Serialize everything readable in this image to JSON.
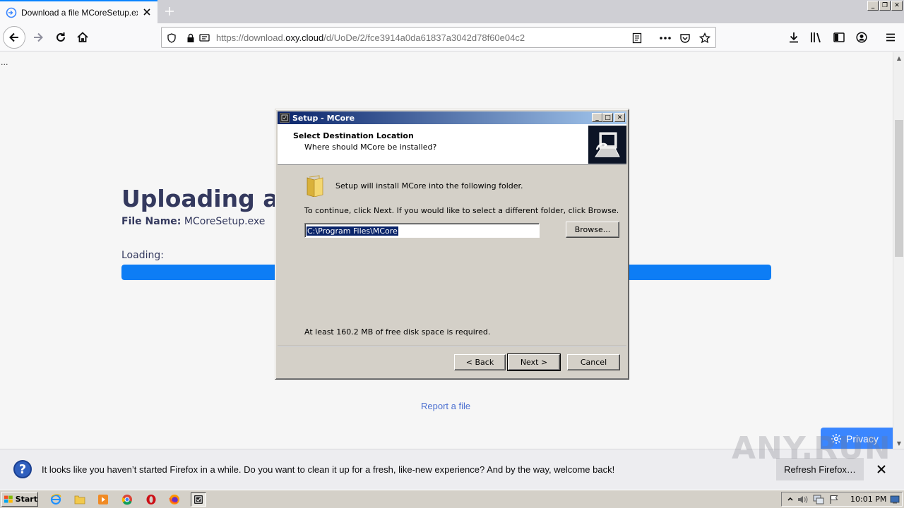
{
  "browser": {
    "tab_title": "Download a file MCoreSetup.exe o",
    "url_prefix": "https://download.",
    "url_domain": "oxy.cloud",
    "url_path": "/d/UoDe/2/fce3914a0da61837a3042d78f60e04c2"
  },
  "page": {
    "ellipsis": "...",
    "heading": "Uploading a",
    "file_name_label": "File Name:",
    "file_name_value": "MCoreSetup.exe",
    "loading_label": "Loading:",
    "progress_fraction": 1.0,
    "report_link": "Report a file",
    "privacy_label": "Privacy"
  },
  "dialog": {
    "title": "Setup - MCore",
    "header_title": "Select Destination Location",
    "header_subtitle": "Where should MCore be installed?",
    "install_info": "Setup will install MCore into the following folder.",
    "continue_info": "To continue, click Next. If you would like to select a different folder, click Browse.",
    "path_value": "C:\\Program Files\\MCore",
    "browse_label": "Browse...",
    "disk_space": "At least 160.2 MB of free disk space is required.",
    "back_label": "< Back",
    "next_label": "Next >",
    "cancel_label": "Cancel"
  },
  "notification": {
    "message": "It looks like you haven’t started Firefox in a while. Do you want to clean it up for a fresh, like-new experience? And by the way, welcome back!",
    "refresh_label": "Refresh Firefox…"
  },
  "watermark": "ANY.RUN",
  "taskbar": {
    "start_label": "Start",
    "clock": "10:01 PM"
  },
  "colors": {
    "accent": "#0a84ff",
    "progress": "#0d7df5",
    "heading": "#34395e",
    "dialog_titlebar": "#0a246a",
    "privacy_button": "#3a86ff"
  }
}
